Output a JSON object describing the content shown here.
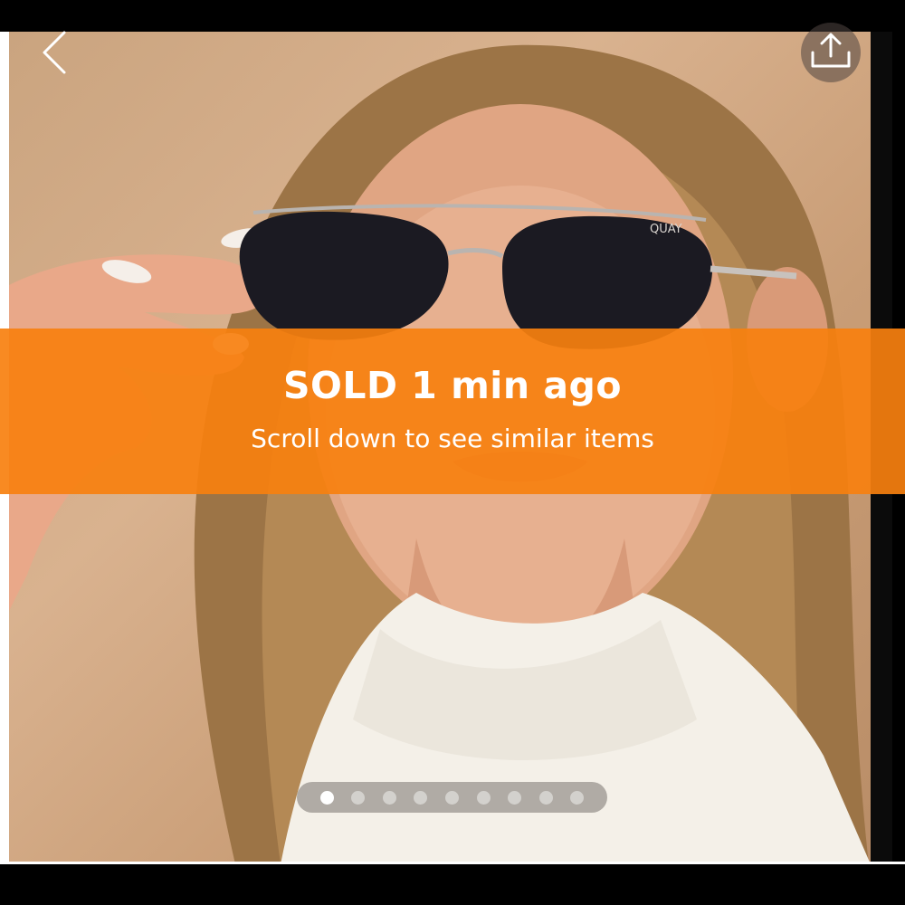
{
  "banner": {
    "title": "SOLD 1 min ago",
    "subtitle": "Scroll down to see similar items",
    "color": "#F7800F"
  },
  "photo": {
    "brand_text_on_glasses": "QUAY"
  },
  "navigation": {
    "back_icon": "chevron-left-icon",
    "share_icon": "share-upload-icon"
  },
  "carousel": {
    "total_images": 9,
    "active_index": 0
  }
}
